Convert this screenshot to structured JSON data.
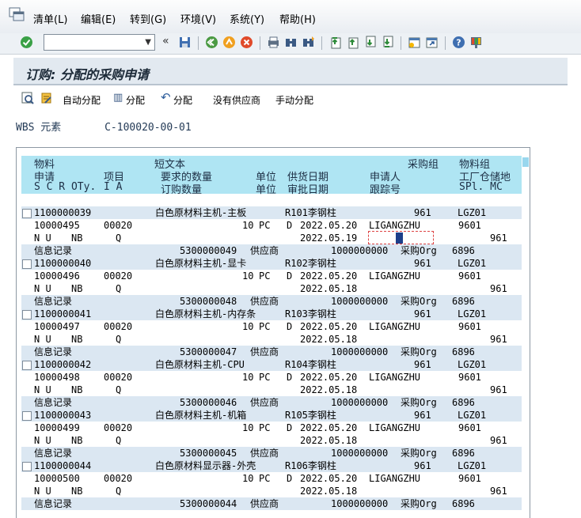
{
  "menu": [
    "清单(L)",
    "编辑(E)",
    "转到(G)",
    "环境(V)",
    "系统(Y)",
    "帮助(H)"
  ],
  "toolbar": {
    "command_field": "",
    "icons": [
      "enter-icon",
      "command-field",
      "back-arrows-icon",
      "save-icon",
      "back-icon",
      "exit-icon",
      "cancel-icon",
      "print-icon",
      "find-icon",
      "find-next-icon",
      "first-page-icon",
      "prev-page-icon",
      "next-page-icon",
      "last-page-icon",
      "create-session-icon",
      "shortcut-icon",
      "help-icon",
      "customize-layout-icon"
    ]
  },
  "title": "订购: 分配的采购申请",
  "app_toolbar": {
    "auto_assign": "自动分配",
    "assign": "分配",
    "assign2": "分配",
    "no_vendor": "没有供应商",
    "manual_assign": "手动分配"
  },
  "wbs": {
    "label": "WBS 元素",
    "value": "C-100020-00-01"
  },
  "header": {
    "l1": [
      "物料",
      "短文本",
      "采购组",
      "物料组"
    ],
    "l2": [
      "申请",
      "项目",
      "要求的数量",
      "单位",
      "供货日期",
      "申请人",
      "工厂仓储地"
    ],
    "l3": [
      "S C R OTy.",
      "I A",
      "订购数量",
      "单位",
      "审批日期",
      "跟踪号",
      "SPl. MC"
    ]
  },
  "rows": [
    {
      "material": "1100000039",
      "text": "白色原材料主机-主板",
      "fixed": "R101李钢柱",
      "pgrp": "961",
      "mgrp": "LGZ01",
      "req": "10000495",
      "item": "00020",
      "qty": "10",
      "unit": "PC",
      "d": "D",
      "date": "2022.05.20",
      "requester": "LIGANGZHU",
      "plant": "9601",
      "s": "N U",
      "ty": "NB",
      "a": "Q",
      "adate": "2022.05.19",
      "spl": "961",
      "info": "信息记录",
      "vendor": "5300000049",
      "vlabel": "供应商",
      "order": "1000000000",
      "porg_label": "采购Org",
      "porg": "6896"
    },
    {
      "material": "1100000040",
      "text": "白色原材料主机-显卡",
      "fixed": "R102李钢柱",
      "pgrp": "961",
      "mgrp": "LGZ01",
      "req": "10000496",
      "item": "00020",
      "qty": "10",
      "unit": "PC",
      "d": "D",
      "date": "2022.05.20",
      "requester": "LIGANGZHU",
      "plant": "9601",
      "s": "N U",
      "ty": "NB",
      "a": "Q",
      "adate": "2022.05.18",
      "spl": "961",
      "info": "信息记录",
      "vendor": "5300000048",
      "vlabel": "供应商",
      "order": "1000000000",
      "porg_label": "采购Org",
      "porg": "6896"
    },
    {
      "material": "1100000041",
      "text": "白色原材料主机-内存条",
      "fixed": "R103李钢柱",
      "pgrp": "961",
      "mgrp": "LGZ01",
      "req": "10000497",
      "item": "00020",
      "qty": "10",
      "unit": "PC",
      "d": "D",
      "date": "2022.05.20",
      "requester": "LIGANGZHU",
      "plant": "9601",
      "s": "N U",
      "ty": "NB",
      "a": "Q",
      "adate": "2022.05.18",
      "spl": "961",
      "info": "信息记录",
      "vendor": "5300000047",
      "vlabel": "供应商",
      "order": "1000000000",
      "porg_label": "采购Org",
      "porg": "6896"
    },
    {
      "material": "1100000042",
      "text": "白色原材料主机-CPU",
      "fixed": "R104李钢柱",
      "pgrp": "961",
      "mgrp": "LGZ01",
      "req": "10000498",
      "item": "00020",
      "qty": "10",
      "unit": "PC",
      "d": "D",
      "date": "2022.05.20",
      "requester": "LIGANGZHU",
      "plant": "9601",
      "s": "N U",
      "ty": "NB",
      "a": "Q",
      "adate": "2022.05.18",
      "spl": "961",
      "info": "信息记录",
      "vendor": "5300000046",
      "vlabel": "供应商",
      "order": "1000000000",
      "porg_label": "采购Org",
      "porg": "6896"
    },
    {
      "material": "1100000043",
      "text": "白色原材料主机-机箱",
      "fixed": "R105李钢柱",
      "pgrp": "961",
      "mgrp": "LGZ01",
      "req": "10000499",
      "item": "00020",
      "qty": "10",
      "unit": "PC",
      "d": "D",
      "date": "2022.05.20",
      "requester": "LIGANGZHU",
      "plant": "9601",
      "s": "N U",
      "ty": "NB",
      "a": "Q",
      "adate": "2022.05.18",
      "spl": "961",
      "info": "信息记录",
      "vendor": "5300000045",
      "vlabel": "供应商",
      "order": "1000000000",
      "porg_label": "采购Org",
      "porg": "6896"
    },
    {
      "material": "1100000044",
      "text": "白色原材料显示器-外壳",
      "fixed": "R106李钢柱",
      "pgrp": "961",
      "mgrp": "LGZ01",
      "req": "10000500",
      "item": "00020",
      "qty": "10",
      "unit": "PC",
      "d": "D",
      "date": "2022.05.20",
      "requester": "LIGANGZHU",
      "plant": "9601",
      "s": "N U",
      "ty": "NB",
      "a": "Q",
      "adate": "2022.05.18",
      "spl": "961",
      "info": "信息记录",
      "vendor": "5300000044",
      "vlabel": "供应商",
      "order": "1000000000",
      "porg_label": "采购Org",
      "porg": "6896"
    }
  ]
}
